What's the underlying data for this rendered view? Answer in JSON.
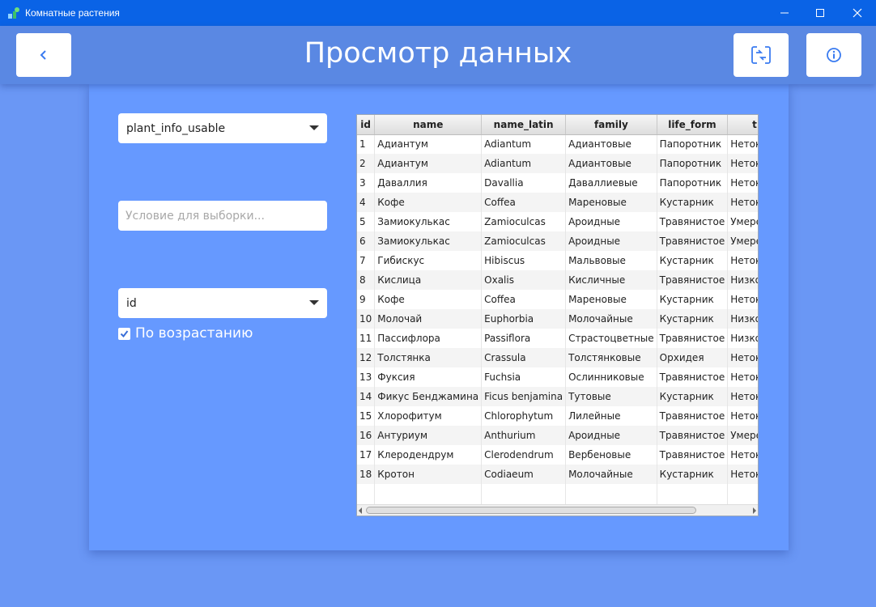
{
  "window": {
    "title": "Комнатные растения"
  },
  "header": {
    "title": "Просмотр данных"
  },
  "filters": {
    "table_select": "plant_info_usable",
    "condition_placeholder": "Условие для выборки...",
    "sort_select": "id",
    "ascending_label": "По возрастанию",
    "ascending_checked": true
  },
  "table": {
    "columns": [
      "id",
      "name",
      "name_latin",
      "family",
      "life_form",
      "t"
    ],
    "rows": [
      [
        "1",
        "Адиантум",
        "Adiantum",
        "Адиантовые",
        "Папоротник",
        "Нетоксич"
      ],
      [
        "2",
        "Адиантум",
        "Adiantum",
        "Адиантовые",
        "Папоротник",
        "Нетоксич"
      ],
      [
        "3",
        "Даваллия",
        "Davallia",
        "Даваллиевые",
        "Папоротник",
        "Нетоксич"
      ],
      [
        "4",
        "Кофе",
        "Coffea",
        "Мареновые",
        "Кустарник",
        "Нетоксич"
      ],
      [
        "5",
        "Замиокулькас",
        "Zamioculcas",
        "Ароидные",
        "Травянистое",
        "Умеренн"
      ],
      [
        "6",
        "Замиокулькас",
        "Zamioculcas",
        "Ароидные",
        "Травянистое",
        "Умеренн"
      ],
      [
        "7",
        "Гибискус",
        "Hibiscus",
        "Мальвовые",
        "Кустарник",
        "Нетоксич"
      ],
      [
        "8",
        "Кислица",
        "Oxalis",
        "Кисличные",
        "Травянистое",
        "Низкото"
      ],
      [
        "9",
        "Кофе",
        "Coffea",
        "Мареновые",
        "Кустарник",
        "Нетоксич"
      ],
      [
        "10",
        "Молочай",
        "Euphorbia",
        "Молочайные",
        "Кустарник",
        "Низкото"
      ],
      [
        "11",
        "Пассифлора",
        "Passiflora",
        "Страстоцветные",
        "Травянистое",
        "Низкото"
      ],
      [
        "12",
        "Толстянка",
        "Crassula",
        "Толстянковые",
        "Орхидея",
        "Нетоксич"
      ],
      [
        "13",
        "Фуксия",
        "Fuchsia",
        "Ослинниковые",
        "Травянистое",
        "Нетоксич"
      ],
      [
        "14",
        "Фикус Бенджамина",
        "Ficus benjamina",
        "Тутовые",
        "Кустарник",
        "Нетоксич"
      ],
      [
        "15",
        "Хлорофитум",
        "Chlorophytum",
        "Лилейные",
        "Травянистое",
        "Нетоксич"
      ],
      [
        "16",
        "Антуриум",
        "Anthurium",
        "Ароидные",
        "Травянистое",
        "Умеренн"
      ],
      [
        "17",
        "Клеродендрум",
        "Clerodendrum",
        "Вербеновые",
        "Травянистое",
        "Нетоксич"
      ],
      [
        "18",
        "Кротон",
        "Codiaeum",
        "Молочайные",
        "Кустарник",
        "Нетоксич"
      ]
    ]
  },
  "icons": {
    "back": "chevron-left-icon",
    "refresh": "swap-icon",
    "info": "info-icon"
  },
  "colors": {
    "titlebar": "#0a63e6",
    "header": "#5a88e3",
    "panel": "#6699ff",
    "background": "#6a97f5",
    "accent": "#3a7bf0"
  }
}
